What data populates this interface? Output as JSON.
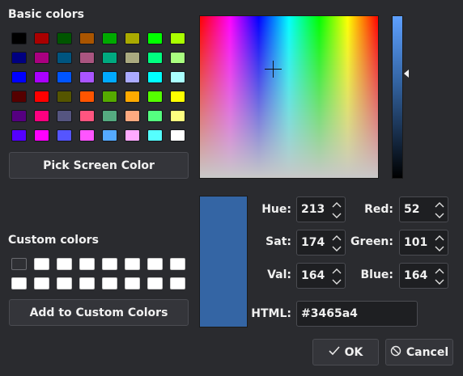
{
  "basic_colors": {
    "title": "Basic colors",
    "swatches": [
      "#000000",
      "#aa0000",
      "#005500",
      "#aa5500",
      "#00aa00",
      "#aaaa00",
      "#00ff00",
      "#aaff00",
      "#000080",
      "#aa0080",
      "#005580",
      "#aa5580",
      "#00aa80",
      "#aaaa80",
      "#00ff80",
      "#aaff80",
      "#0000ff",
      "#aa00ff",
      "#0055ff",
      "#aa55ff",
      "#00aaff",
      "#aaaaff",
      "#00ffff",
      "#aaffff",
      "#550000",
      "#ff0000",
      "#555500",
      "#ff5500",
      "#55aa00",
      "#ffaa00",
      "#55ff00",
      "#ffff00",
      "#550080",
      "#ff0080",
      "#555580",
      "#ff5580",
      "#55aa80",
      "#ffaa80",
      "#55ff80",
      "#ffff80",
      "#5500ff",
      "#ff00ff",
      "#5555ff",
      "#ff55ff",
      "#55aaff",
      "#ffaaff",
      "#55ffff",
      "#ffffff"
    ]
  },
  "pick_screen_color_label": "Pick Screen Color",
  "custom_colors": {
    "title": "Custom colors",
    "count": 16,
    "selected_index": 0
  },
  "add_custom_label": "Add to Custom Colors",
  "current_color": "#3465a4",
  "fields": {
    "hue": {
      "label": "Hue:",
      "value": "213"
    },
    "sat": {
      "label": "Sat:",
      "value": "174"
    },
    "val": {
      "label": "Val:",
      "value": "164"
    },
    "red": {
      "label": "Red:",
      "value": "52"
    },
    "green": {
      "label": "Green:",
      "value": "101"
    },
    "blue": {
      "label": "Blue:",
      "value": "164"
    },
    "html": {
      "label": "HTML:",
      "value": "#3465a4"
    }
  },
  "buttons": {
    "ok": {
      "label": "OK",
      "icon": "check-icon"
    },
    "cancel": {
      "label": "Cancel",
      "icon": "cancel-icon"
    }
  }
}
